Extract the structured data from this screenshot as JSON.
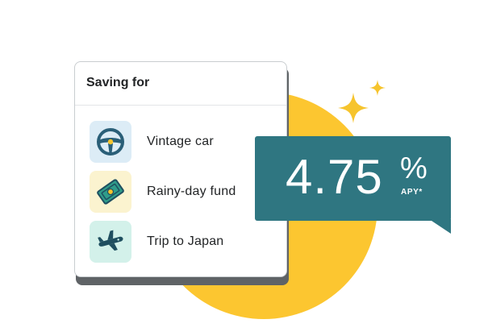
{
  "card": {
    "title": "Saving for",
    "items": [
      {
        "label": "Vintage car",
        "icon": "steering-wheel-icon",
        "tile_color": "#dcecf6"
      },
      {
        "label": "Rainy-day fund",
        "icon": "money-bill-icon",
        "tile_color": "#fbf3cf"
      },
      {
        "label": "Trip to Japan",
        "icon": "airplane-icon",
        "tile_color": "#d3f1ea"
      }
    ]
  },
  "rate": {
    "value": "4.75",
    "percent": "%",
    "label": "APY*",
    "box_color": "#2f7681"
  },
  "accent": {
    "sun": "#fcc630",
    "sparkle": "#f6c42d"
  }
}
